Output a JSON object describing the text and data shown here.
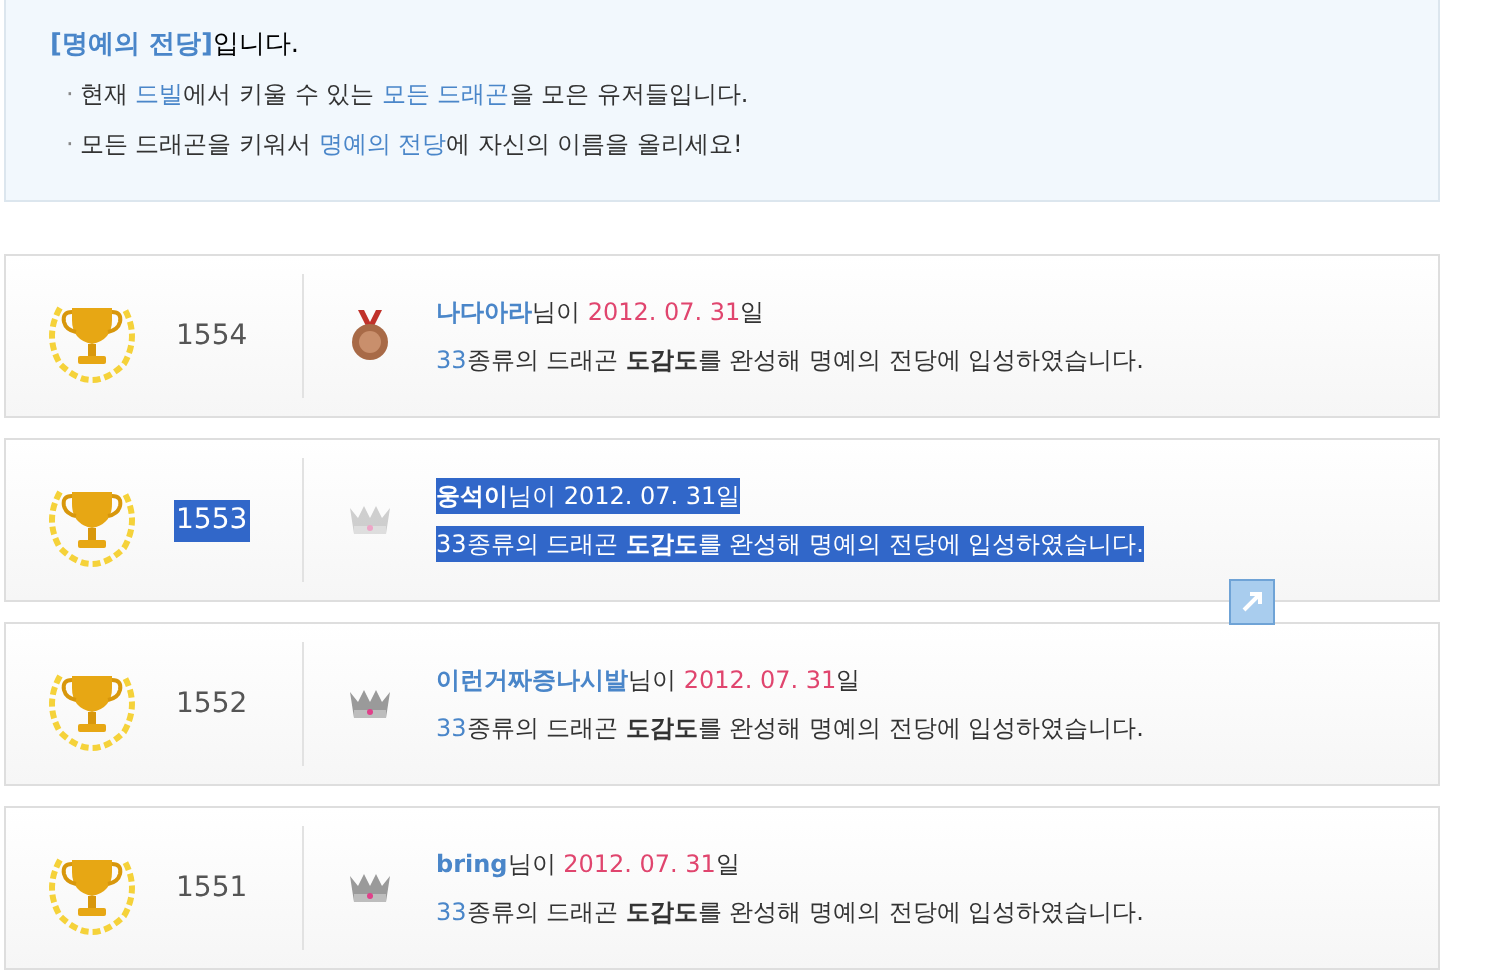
{
  "intro": {
    "title": "[명예의 전당]",
    "title_suffix": "입니다.",
    "bullets": [
      {
        "marker": "·",
        "segments": [
          {
            "text": "현재 ",
            "highlight": false
          },
          {
            "text": "드빌",
            "highlight": true
          },
          {
            "text": "에서 키울 수 있는 ",
            "highlight": false
          },
          {
            "text": "모든 드래곤",
            "highlight": true
          },
          {
            "text": "을 모은 유저들입니다.",
            "highlight": false
          }
        ]
      },
      {
        "marker": "·",
        "segments": [
          {
            "text": "모든 드래곤을 키워서 ",
            "highlight": false
          },
          {
            "text": "명예의 전당",
            "highlight": true
          },
          {
            "text": "에 자신의 이름을 올리세요!",
            "highlight": false
          }
        ]
      }
    ]
  },
  "entries": [
    {
      "rank": "1554",
      "kind": "medal",
      "selected": false,
      "name": "나다아라",
      "name_suffix": "님이",
      "date": "2012. 07. 31",
      "date_suffix": "일",
      "count": "33",
      "description": "종류의 드래곤 **도감도**를 완성해 명예의 전당에 입성하였습니다."
    },
    {
      "rank": "1553",
      "kind": "crown",
      "selected": true,
      "name": "웅석이",
      "name_suffix": "님이",
      "date": "2012. 07. 31",
      "date_suffix": "일",
      "count": "33",
      "description": "종류의 드래곤 **도감도**를 완성해 명예의 전당에 입성하였습니다."
    },
    {
      "rank": "1552",
      "kind": "crown",
      "selected": false,
      "name": "이런거짜증나시발",
      "name_suffix": "님이",
      "date": "2012. 07. 31",
      "date_suffix": "일",
      "count": "33",
      "description": "종류의 드래곤 **도감도**를 완성해 명예의 전당에 입성하였습니다."
    },
    {
      "rank": "1551",
      "kind": "crown",
      "selected": false,
      "name": "bring",
      "name_suffix": "님이",
      "date": "2012. 07. 31",
      "date_suffix": "일",
      "count": "33",
      "description": "종류의 드래곤 **도감도**를 완성해 명예의 전당에 입성하였습니다."
    }
  ]
}
